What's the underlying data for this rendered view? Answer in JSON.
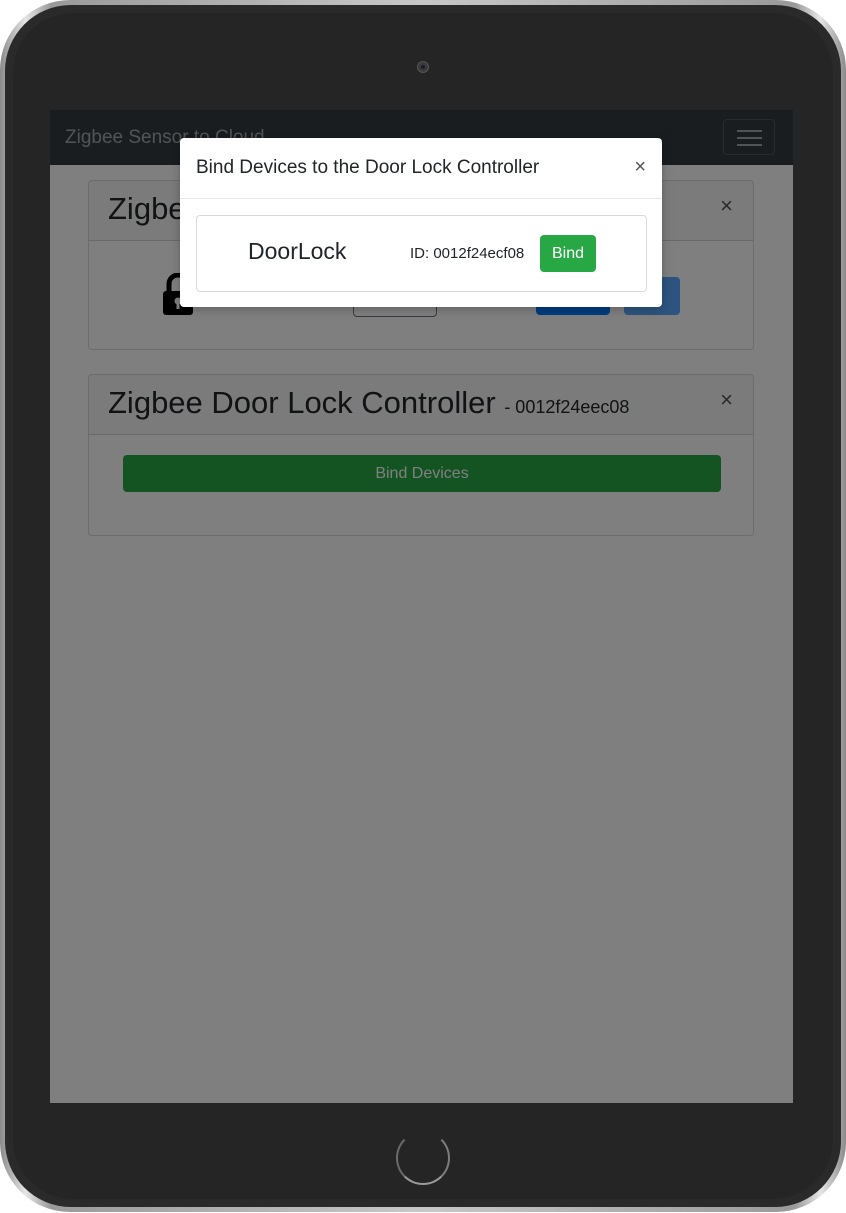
{
  "navbar": {
    "brand": "Zigbee Sensor to Cloud",
    "menu_icon": "hamburger-menu-icon"
  },
  "cards": {
    "door_lock": {
      "title_partial": "Zigbee Door Lock",
      "close": "×",
      "lock_icon": "lock-icon",
      "partial_button_text": "<"
    },
    "controller": {
      "title": "Zigbee Door Lock Controller",
      "id": "- 0012f24eec08",
      "close": "×",
      "bind_devices_label": "Bind Devices"
    }
  },
  "modal": {
    "title": "Bind Devices to the Door Lock Controller",
    "close": "×",
    "devices": [
      {
        "name": "DoorLock",
        "id_text": "ID: 0012f24ecf08",
        "bind_label": "Bind"
      }
    ]
  },
  "colors": {
    "navbar": "#343a40",
    "success": "#28a745",
    "primary": "#007bff",
    "backdrop": "rgba(0,0,0,0.5)"
  }
}
